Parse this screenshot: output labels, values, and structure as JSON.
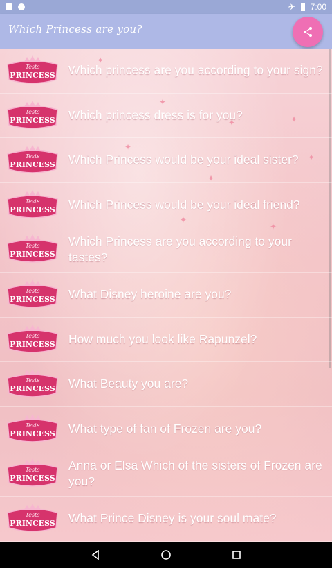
{
  "status_bar": {
    "time": "7:00"
  },
  "app_bar": {
    "title": "Which Princess are you?"
  },
  "logo": {
    "small_text": "Tests",
    "big_text": "PRINCESS"
  },
  "quizzes": [
    {
      "label": "Which princess are you according to your sign?"
    },
    {
      "label": "Which princess dress is for you?"
    },
    {
      "label": "Which Princess would be your ideal sister?"
    },
    {
      "label": "Which Princess would be your ideal friend?"
    },
    {
      "label": "Which Princess are you according to your tastes?"
    },
    {
      "label": "What Disney heroine are you?"
    },
    {
      "label": "How much you look like Rapunzel?"
    },
    {
      "label": "What Beauty you are?"
    },
    {
      "label": "What type of fan of Frozen are you?"
    },
    {
      "label": "Anna or Elsa Which of the sisters of Frozen are you?"
    },
    {
      "label": "What Prince Disney is your soul mate?"
    }
  ],
  "colors": {
    "app_bar": "#aeb8e6",
    "fab": "#ef6fb4",
    "logo_pink": "#d6336c"
  }
}
